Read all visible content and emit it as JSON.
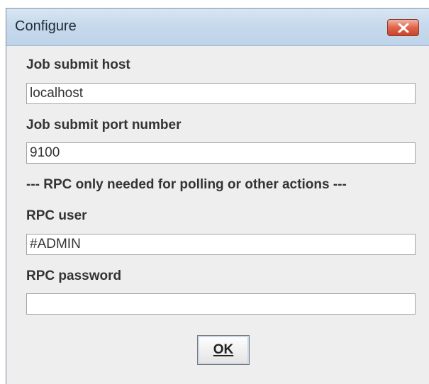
{
  "window": {
    "title": "Configure"
  },
  "form": {
    "host_label": "Job submit host",
    "host_value": "localhost",
    "port_label": "Job submit port number",
    "port_value": "9100",
    "rpc_separator": "--- RPC only needed for polling or other actions ---",
    "rpc_user_label": "RPC user",
    "rpc_user_value": "#ADMIN",
    "rpc_password_label": "RPC password",
    "rpc_password_value": ""
  },
  "buttons": {
    "ok_label": "OK",
    "close_icon": "close-x-icon"
  },
  "colors": {
    "titlebar": "#c7d9ec",
    "close_button": "#e0634a",
    "dialog_background": "#eeeeee"
  }
}
